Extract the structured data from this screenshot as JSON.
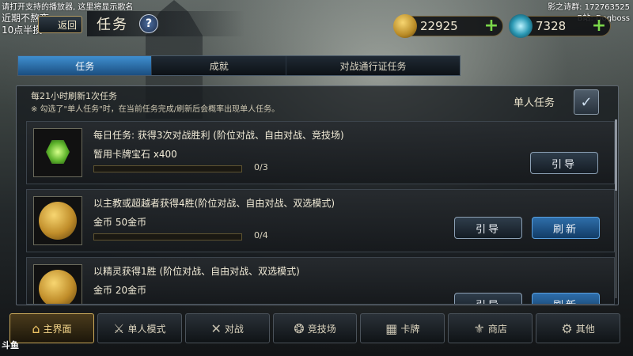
{
  "overlay": {
    "top_left": "请打开支持的播放器, 这里将显示歌名",
    "schedule_line1": "近期不熬夜",
    "schedule_line2": "10点半摸",
    "top_right": "影之诗群: 172763525",
    "bili": "B站: Dogboss"
  },
  "header": {
    "back_label": "返回",
    "title": "任务",
    "help_icon": "?",
    "gold": {
      "icon": "gold-coin-icon",
      "value": "22925",
      "plus": "+"
    },
    "crystal": {
      "icon": "crystal-icon",
      "value": "7328",
      "plus": "+"
    }
  },
  "tabs": [
    {
      "label": "任务",
      "active": true
    },
    {
      "label": "成就",
      "active": false
    },
    {
      "label": "对战通行证任务",
      "active": false
    }
  ],
  "panel": {
    "refresh_note": "每21小时刷新1次任务",
    "hint_note": "※ 勾选了\"单人任务\"时，在当前任务完成/刷新后会概率出现单人任务。",
    "solo_label": "单人任务",
    "solo_check": "✓"
  },
  "quests": [
    {
      "icon": "emerald-gem-icon",
      "title": "每日任务: 获得3次对战胜利 (阶位对战、自由对战、竞技场)",
      "reward": "暂用卡牌宝石 x400",
      "progress_text": "0/3",
      "progress": 0,
      "buttons": [
        {
          "label": "引导",
          "style": "normal"
        }
      ]
    },
    {
      "icon": "gold-coins-icon",
      "title": "以主教或超越者获得4胜(阶位对战、自由对战、双选模式)",
      "reward": "金币 50金币",
      "progress_text": "0/4",
      "progress": 0,
      "buttons": [
        {
          "label": "引导",
          "style": "normal"
        },
        {
          "label": "刷新",
          "style": "primary"
        }
      ]
    },
    {
      "icon": "gold-coins-icon",
      "title": "以精灵获得1胜 (阶位对战、自由对战、双选模式)",
      "reward": "金币 20金币",
      "progress_text": "",
      "progress": 0,
      "buttons": [
        {
          "label": "引导",
          "style": "normal"
        },
        {
          "label": "刷新",
          "style": "primary"
        }
      ]
    }
  ],
  "bottom_nav": [
    {
      "icon": "home-icon",
      "glyph": "⌂",
      "label": "主界面",
      "active": true
    },
    {
      "icon": "sword-icon",
      "glyph": "⚔",
      "label": "单人模式",
      "active": false
    },
    {
      "icon": "crossed-swords-icon",
      "glyph": "✕",
      "label": "对战",
      "active": false
    },
    {
      "icon": "arena-icon",
      "glyph": "❂",
      "label": "竞技场",
      "active": false
    },
    {
      "icon": "cards-icon",
      "glyph": "▦",
      "label": "卡牌",
      "active": false
    },
    {
      "icon": "shop-icon",
      "glyph": "⚜",
      "label": "商店",
      "active": false
    },
    {
      "icon": "other-icon",
      "glyph": "⚙",
      "label": "其他",
      "active": false
    }
  ],
  "corner_logo": "斗鱼"
}
